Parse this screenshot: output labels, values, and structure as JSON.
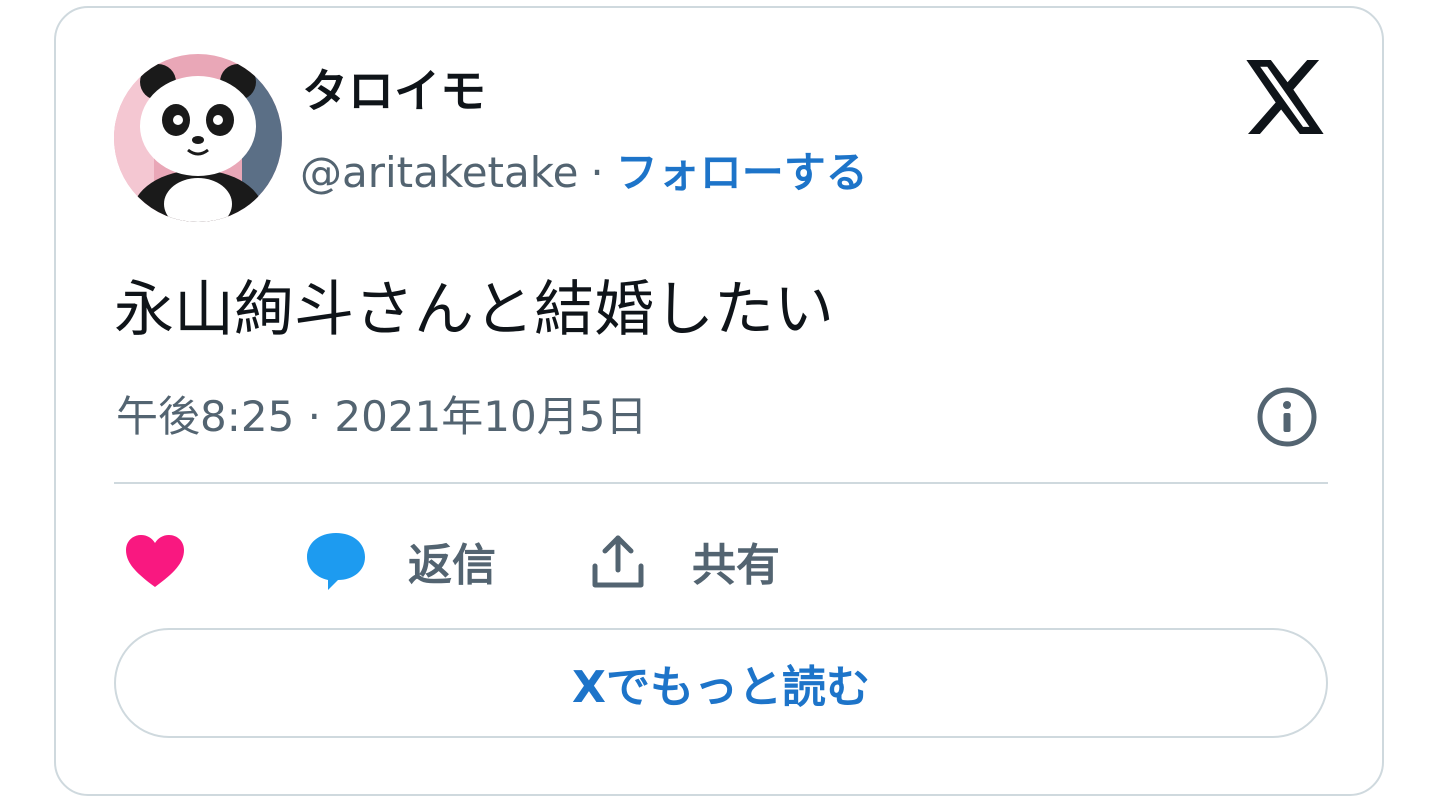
{
  "author": {
    "display_name": "タロイモ",
    "handle": "@aritaketake",
    "separator": "·",
    "follow_label": "フォローする",
    "avatar_icon": "panda-avatar"
  },
  "brand_icon": "x-logo-icon",
  "tweet": {
    "text": "永山絢斗さんと結婚したい",
    "timestamp": "午後8:25 · 2021年10月5日"
  },
  "actions": {
    "like_icon": "heart-icon",
    "reply_icon": "speech-bubble-icon",
    "reply_label": "返信",
    "share_icon": "share-upload-icon",
    "share_label": "共有"
  },
  "more_button_label": "Xでもっと読む",
  "colors": {
    "accent": "#1d74c9",
    "like": "#f91880",
    "reply": "#1d9bf0",
    "muted": "#536471",
    "text": "#0f1419",
    "border": "#cfd9de"
  }
}
